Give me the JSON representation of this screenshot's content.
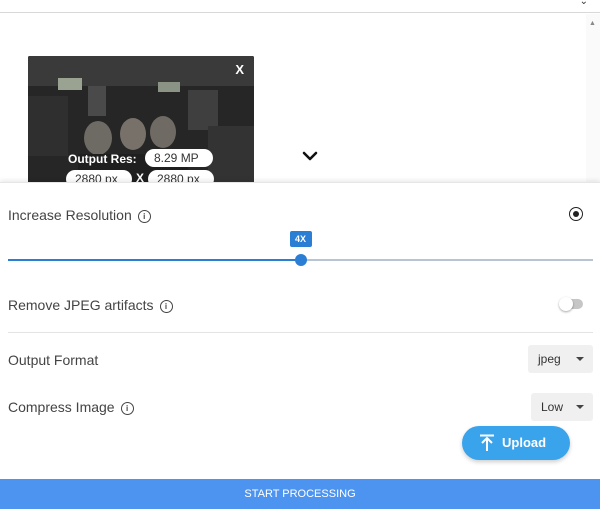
{
  "preview": {
    "close_label": "X",
    "output_res_label": "Output Res:",
    "megapixels": "8.29 MP",
    "width_value": "2880 px",
    "height_value": "2880 px",
    "size_separator": "X"
  },
  "settings": {
    "increase_resolution": {
      "label": "Increase Resolution",
      "scale_label": "4X",
      "slider_fraction": 0.5,
      "selected": true
    },
    "remove_artifacts": {
      "label": "Remove JPEG artifacts",
      "enabled": false
    },
    "output_format": {
      "label": "Output Format",
      "value": "jpeg"
    },
    "compress_image": {
      "label": "Compress Image",
      "value": "Low"
    }
  },
  "actions": {
    "upload_label": "Upload",
    "start_label": "START PROCESSING"
  },
  "colors": {
    "accent": "#2a7fd4",
    "upload_button": "#39a3ec",
    "start_button": "#4d94f1"
  }
}
